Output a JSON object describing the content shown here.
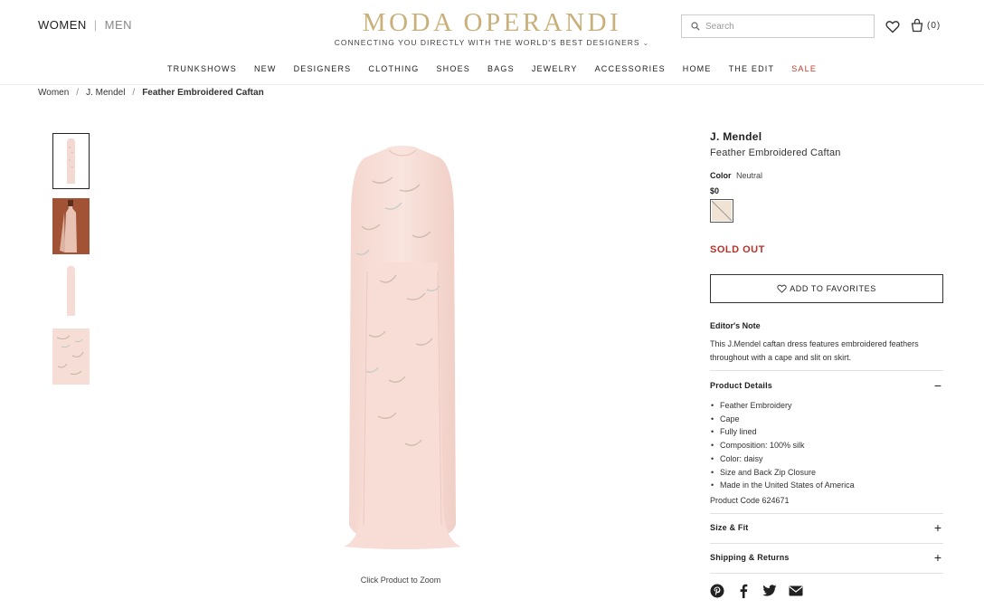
{
  "header": {
    "gender_women": "WOMEN",
    "gender_men": "MEN",
    "logo": "MODA OPERANDI",
    "tagline": "CONNECTING YOU DIRECTLY WITH THE WORLD'S BEST DESIGNERS",
    "search_placeholder": "Search",
    "cart_count": "(0)"
  },
  "nav": {
    "items": [
      "TRUNKSHOWS",
      "NEW",
      "DESIGNERS",
      "CLOTHING",
      "SHOES",
      "BAGS",
      "JEWELRY",
      "ACCESSORIES",
      "HOME",
      "THE EDIT",
      "SALE"
    ]
  },
  "breadcrumb": [
    "Women",
    "J. Mendel",
    "Feather Embroidered Caftan"
  ],
  "gallery": {
    "zoom_hint": "Click Product to Zoom"
  },
  "product": {
    "designer": "J. Mendel",
    "name": "Feather Embroidered Caftan",
    "color_label": "Color",
    "color_value": "Neutral",
    "price": "$0",
    "status": "SOLD OUT",
    "favorites_label": "ADD TO FAVORITES",
    "editors_note_title": "Editor's Note",
    "editors_note": "This J.Mendel caftan dress features embroidered feathers throughout with a cape and slit on skirt.",
    "details_title": "Product Details",
    "details": [
      "Feather Embroidery",
      "Cape",
      "Fully lined",
      "Composition: 100% silk",
      "Color: daisy",
      "Size and Back Zip Closure",
      "Made in the United States of America"
    ],
    "product_code": "Product Code 624671",
    "size_fit_title": "Size & Fit",
    "shipping_title": "Shipping & Returns",
    "toggle_open": "−",
    "toggle_closed": "+"
  },
  "colors": {
    "brand_gold": "#c9b07a",
    "sale_red": "#c0392b",
    "soldout_red": "#b8322a",
    "dress_pink": "#f6ddd6"
  }
}
